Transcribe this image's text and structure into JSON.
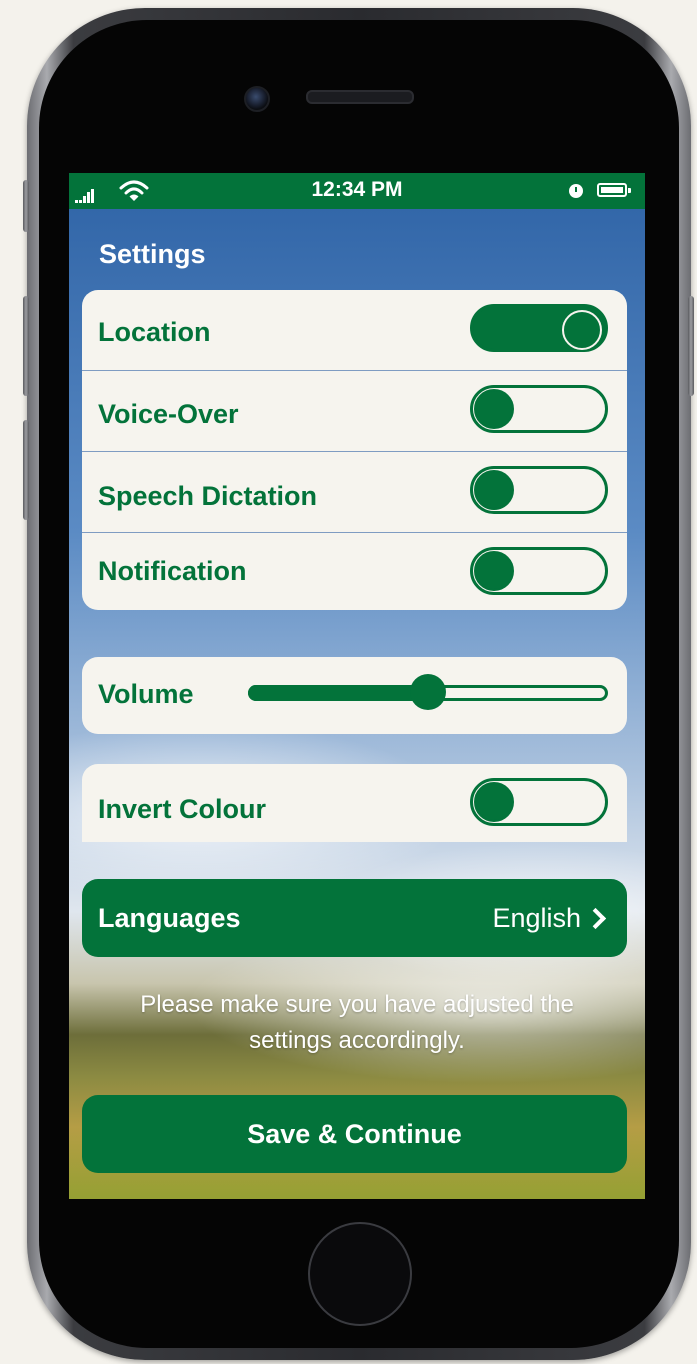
{
  "status_bar": {
    "time": "12:34 PM"
  },
  "screen": {
    "title": "Settings"
  },
  "settings": [
    {
      "label": "Location",
      "state": "on"
    },
    {
      "label": "Voice-Over",
      "state": "off"
    },
    {
      "label": "Speech Dictation",
      "state": "off"
    },
    {
      "label": "Notification",
      "state": "off"
    }
  ],
  "volume": {
    "label": "Volume",
    "level": 0.5
  },
  "invert_colour": {
    "label": "Invert Colour",
    "state": "off"
  },
  "languages": {
    "label": "Languages",
    "value": "English"
  },
  "help_text": "Please make sure you have adjusted the settings accordingly.",
  "save_button": {
    "label": "Save & Continue"
  },
  "colors": {
    "accent": "#03733a",
    "card": "#f6f4ee"
  },
  "icons": [
    "signal-icon",
    "wifi-icon",
    "clock-icon",
    "battery-icon",
    "chevron-right-icon"
  ]
}
